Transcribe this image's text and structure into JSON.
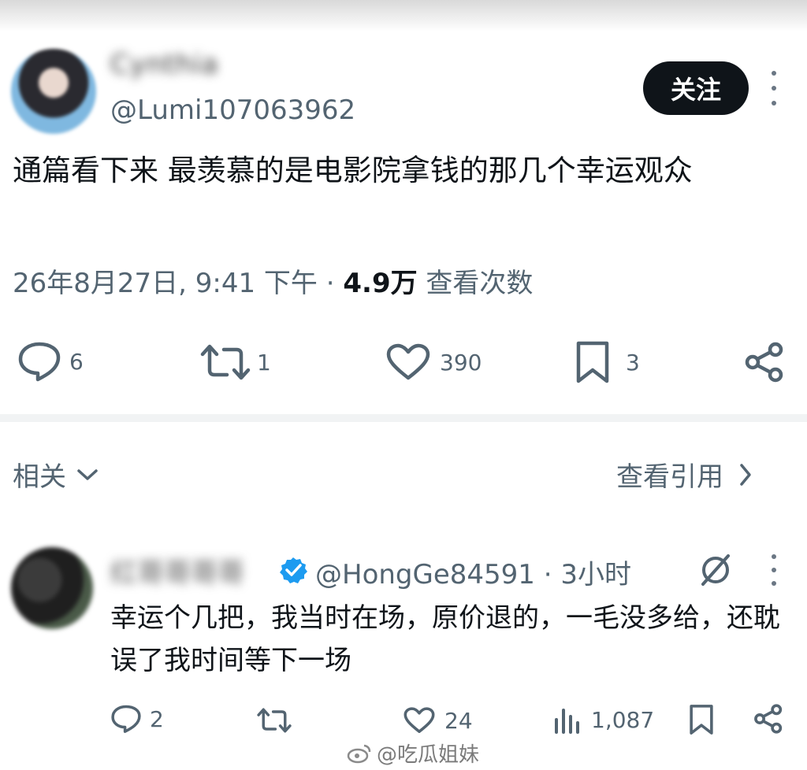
{
  "post": {
    "display_name": "Cynthia",
    "handle": "@Lumi107063962",
    "follow_label": "关注",
    "text": "通篇看下来 最羡慕的是电影院拿钱的那几个幸运观众",
    "timestamp": "26年8月27日, 9:41 下午",
    "separator": " · ",
    "views_count": "4.9万",
    "views_label": " 查看次数",
    "actions": {
      "replies": "6",
      "reposts": "1",
      "likes": "390",
      "bookmarks": "3"
    }
  },
  "related": {
    "label": "相关",
    "view_quotes_label": "查看引用"
  },
  "reply": {
    "display_name": "红哥哥哥哥",
    "handle_time": "@HongGe84591 · 3小时",
    "text": "幸运个几把，我当时在场，原价退的，一毛没多给，还耽误了我时间等下一场",
    "actions": {
      "replies": "2",
      "likes": "24",
      "views": "1,087"
    }
  },
  "watermark": "@吃瓜姐妹",
  "colors": {
    "text_primary": "#0f1419",
    "text_secondary": "#536471",
    "verified_blue": "#1d9bf0",
    "follow_bg": "#0f1419"
  }
}
